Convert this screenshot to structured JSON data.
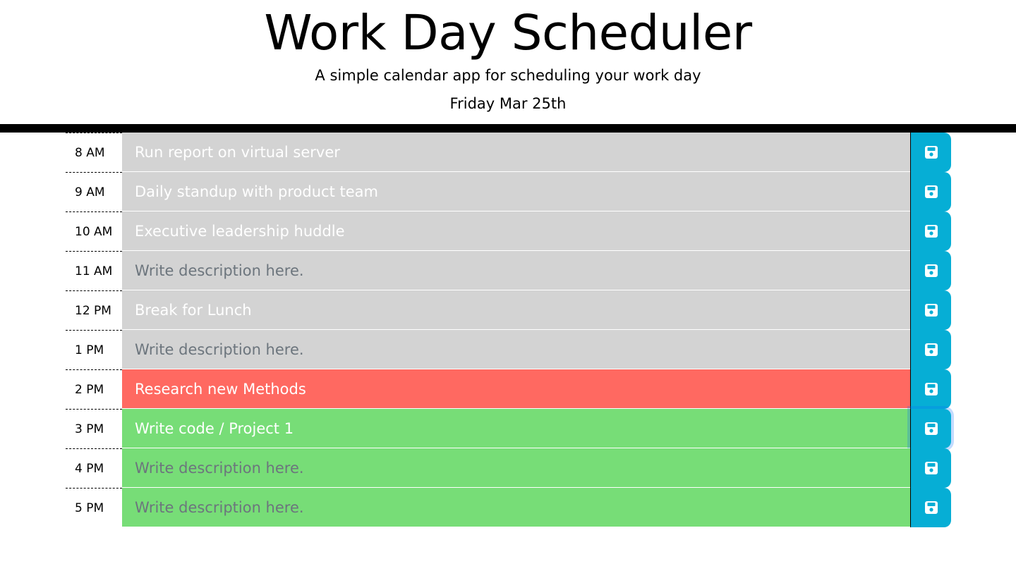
{
  "header": {
    "title": "Work Day Scheduler",
    "subtitle": "A simple calendar app for scheduling your work day",
    "current_day": "Friday Mar 25th"
  },
  "colors": {
    "past": "#d3d3d3",
    "present": "#ff6961",
    "future": "#77dd77",
    "save_button": "#06aed5"
  },
  "time_blocks": [
    {
      "hour": "8 AM",
      "description": "Run report on virtual server",
      "placeholder": "Write description here.",
      "state": "past"
    },
    {
      "hour": "9 AM",
      "description": "Daily standup with product team",
      "placeholder": "Write description here.",
      "state": "past"
    },
    {
      "hour": "10 AM",
      "description": "Executive leadership huddle",
      "placeholder": "Write description here.",
      "state": "past"
    },
    {
      "hour": "11 AM",
      "description": "",
      "placeholder": "Write description here.",
      "state": "past"
    },
    {
      "hour": "12 PM",
      "description": "Break for Lunch",
      "placeholder": "Write description here.",
      "state": "past"
    },
    {
      "hour": "1 PM",
      "description": "",
      "placeholder": "Write description here.",
      "state": "past"
    },
    {
      "hour": "2 PM",
      "description": "Research new Methods",
      "placeholder": "Write description here.",
      "state": "present"
    },
    {
      "hour": "3 PM",
      "description": "Write code / Project 1",
      "placeholder": "Write description here.",
      "state": "future"
    },
    {
      "hour": "4 PM",
      "description": "",
      "placeholder": "Write description here.",
      "state": "future"
    },
    {
      "hour": "5 PM",
      "description": "",
      "placeholder": "Write description here.",
      "state": "future"
    }
  ],
  "save_icon": "floppy-disk-icon"
}
